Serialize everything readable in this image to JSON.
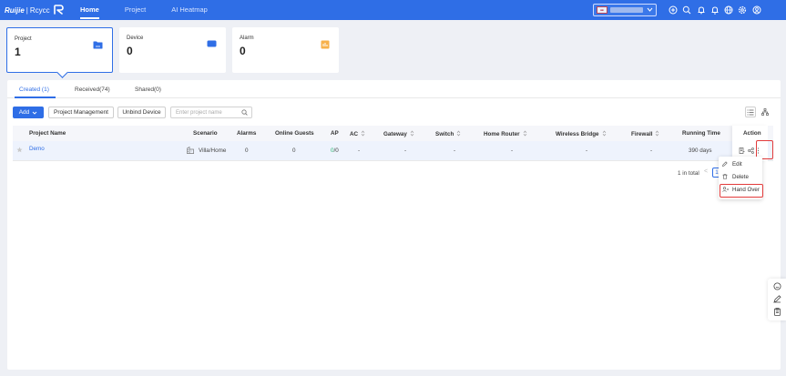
{
  "header": {
    "logo_brand": "Ruijie",
    "logo_separator": "|",
    "logo_product": "Rcycc",
    "nav": [
      {
        "label": "Home",
        "active": true
      },
      {
        "label": "Project",
        "active": false
      },
      {
        "label": "AI Heatmap",
        "active": false
      }
    ],
    "icons": [
      "plus-circle-icon",
      "search-icon",
      "bell-icon",
      "alert-icon",
      "globe-icon",
      "settings-icon",
      "user-icon"
    ]
  },
  "cards": [
    {
      "label": "Project",
      "value": "1",
      "icon": "folder-icon",
      "active": true
    },
    {
      "label": "Device",
      "value": "0",
      "icon": "device-icon",
      "active": false
    },
    {
      "label": "Alarm",
      "value": "0",
      "icon": "alarm-icon",
      "active": false
    }
  ],
  "tabs": [
    "Created (1)",
    "Received(74)",
    "Shared(0)"
  ],
  "toolbar": {
    "add_label": "Add",
    "project_management_label": "Project Management",
    "unbind_device_label": "Unbind Device",
    "search_placeholder": "Enter project name"
  },
  "table": {
    "columns": [
      "Project Name",
      "Scenario",
      "Alarms",
      "Online Guests",
      "AP",
      "AC",
      "Gateway",
      "Switch",
      "Home Router",
      "Wireless Bridge",
      "Firewall",
      "Running Time",
      "Action"
    ],
    "rows": [
      {
        "name": "Demo",
        "scenario": "Villa/Home",
        "alarms": "0",
        "online_guests": "0",
        "ap_online": "0",
        "ap_total": "/0",
        "ac": "-",
        "gateway": "-",
        "switch": "-",
        "home_router": "-",
        "wireless_bridge": "-",
        "firewall": "-",
        "running_time": "390 days"
      }
    ]
  },
  "pagination": {
    "total": "1 in total",
    "prev": "<",
    "page": "1"
  },
  "action_menu": [
    {
      "label": "Edit",
      "icon": "edit-icon"
    },
    {
      "label": "Delete",
      "icon": "trash-icon"
    },
    {
      "label": "Hand Over",
      "icon": "user-transfer-icon"
    }
  ],
  "colors": {
    "primary": "#2f6ee6",
    "highlight": "#e23b3b",
    "online": "#2bb673"
  }
}
